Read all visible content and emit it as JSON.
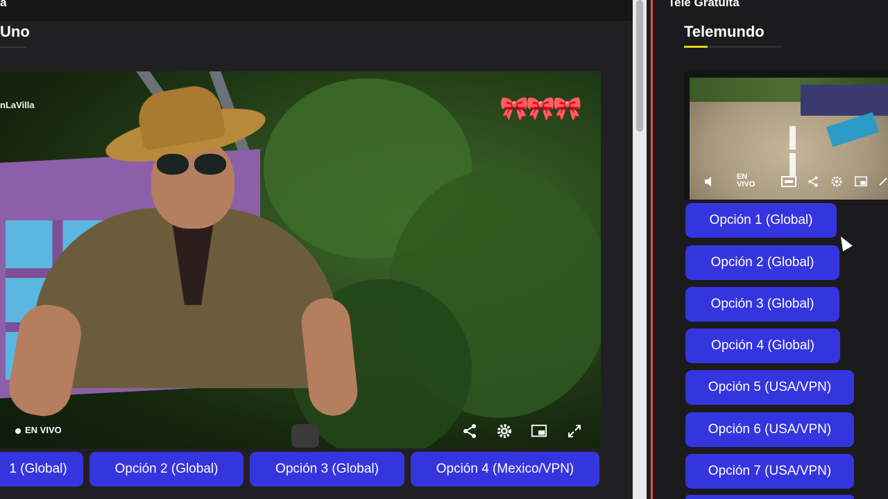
{
  "left_section": {
    "top_title": "a",
    "title": "Uno",
    "watermark": "nLaVilla",
    "live_label": "EN VIVO",
    "buttons": [
      "1 (Global)",
      "Opción 2 (Global)",
      "Opción 3 (Global)",
      "Opción 4 (Mexico/VPN)"
    ]
  },
  "right_section": {
    "top_title": "Tele Gratuita",
    "title": "Telemundo",
    "player_live_label": "EN VIVO",
    "buttons": [
      "Opción 1 (Global)",
      "Opción 2 (Global)",
      "Opción 3 (Global)",
      "Opción 4 (Global)",
      "Opción 5 (USA/VPN)",
      "Opción 6 (USA/VPN)",
      "Opción 7 (USA/VPN)"
    ]
  },
  "colors": {
    "button": "#3535e0",
    "accent_underline": "#e8d21c",
    "divider": "#e0502b",
    "page_bg": "#1d1d1f"
  },
  "icons": [
    "share-icon",
    "gear-icon",
    "picture-in-picture-icon",
    "fullscreen-icon",
    "pause-icon",
    "volume-icon",
    "cc-icon",
    "cursor-icon"
  ]
}
